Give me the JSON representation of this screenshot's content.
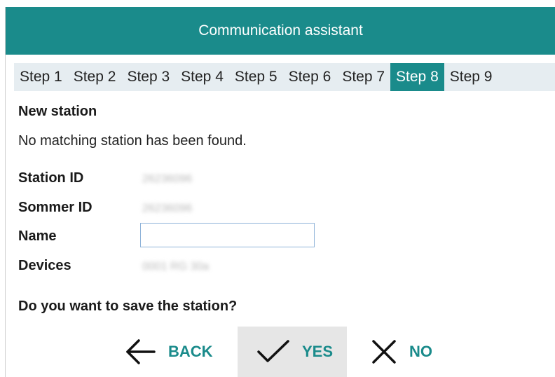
{
  "window": {
    "title": "Communication assistant"
  },
  "steps": [
    {
      "label": "Step 1",
      "active": false
    },
    {
      "label": "Step 2",
      "active": false
    },
    {
      "label": "Step 3",
      "active": false
    },
    {
      "label": "Step 4",
      "active": false
    },
    {
      "label": "Step 5",
      "active": false
    },
    {
      "label": "Step 6",
      "active": false
    },
    {
      "label": "Step 7",
      "active": false
    },
    {
      "label": "Step 8",
      "active": true
    },
    {
      "label": "Step 9",
      "active": false
    }
  ],
  "content": {
    "section_title": "New station",
    "message": "No matching station has been found.",
    "fields": {
      "station_id": {
        "label": "Station ID",
        "value": "26236096"
      },
      "sommer_id": {
        "label": "Sommer ID",
        "value": "26236096"
      },
      "name": {
        "label": "Name",
        "value": "",
        "placeholder": ""
      },
      "devices": {
        "label": "Devices",
        "value": "0001 RG 30a"
      }
    },
    "question": "Do you want to save the station?"
  },
  "actions": {
    "back": {
      "label": "BACK",
      "icon": "arrow-left-icon"
    },
    "yes": {
      "label": "YES",
      "icon": "checkmark-icon"
    },
    "no": {
      "label": "NO",
      "icon": "close-icon"
    }
  },
  "colors": {
    "accent": "#1a8b8b",
    "step_bar_bg": "#e6edf1",
    "yes_button_bg": "#e6e6e6"
  }
}
